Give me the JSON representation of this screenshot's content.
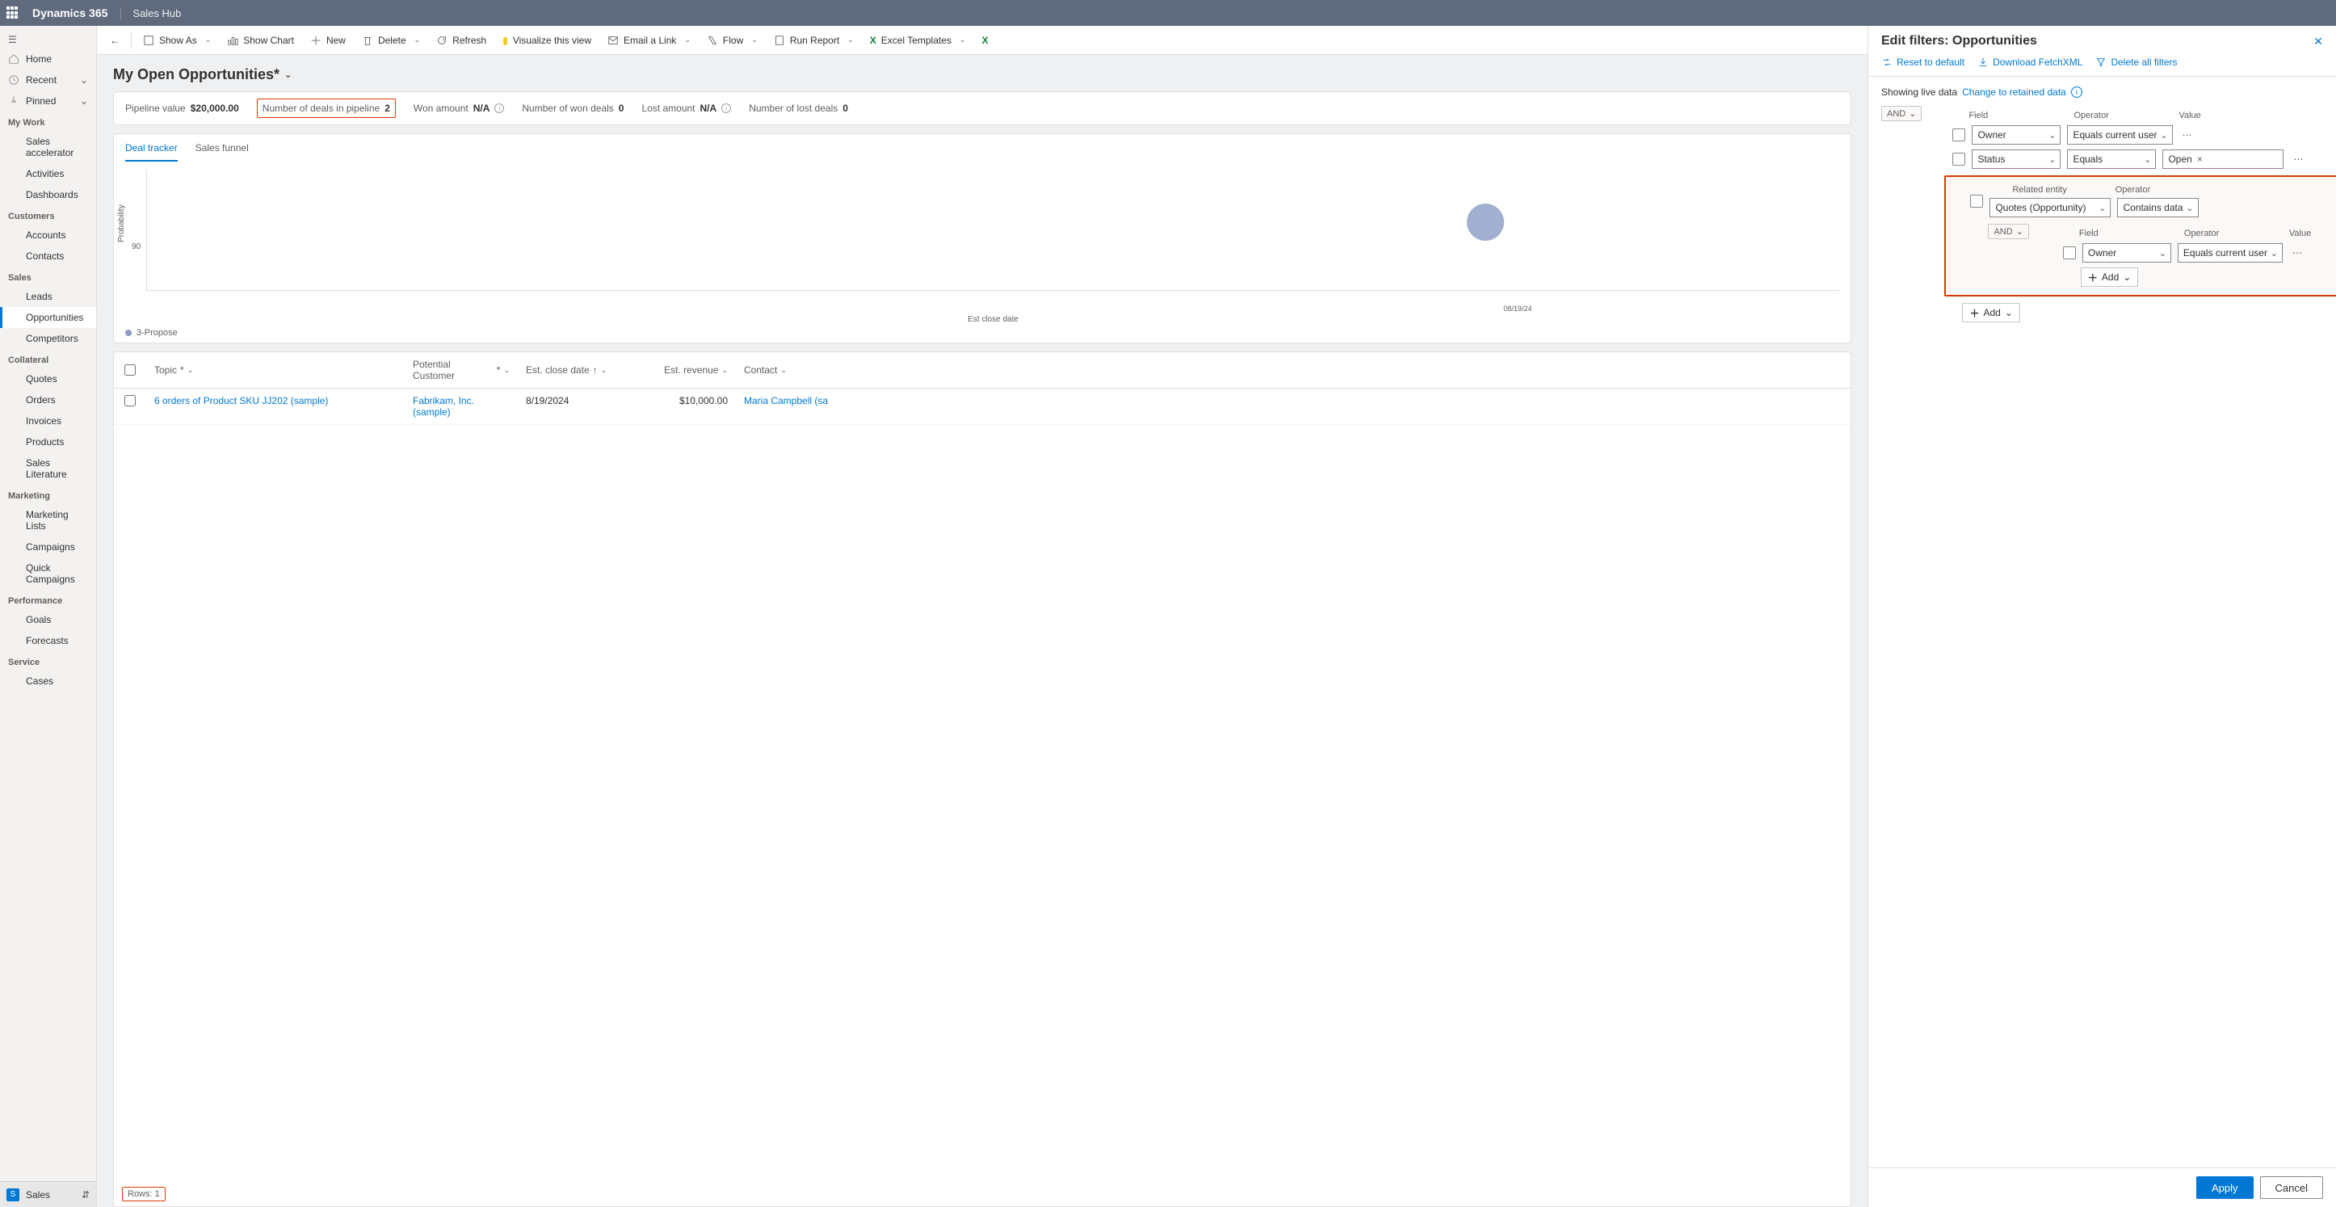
{
  "topbar": {
    "brand": "Dynamics 365",
    "app": "Sales Hub"
  },
  "sidebar": {
    "top": [
      {
        "label": "Home"
      },
      {
        "label": "Recent",
        "chev": true
      },
      {
        "label": "Pinned",
        "chev": true
      }
    ],
    "sections": [
      {
        "title": "My Work",
        "items": [
          "Sales accelerator",
          "Activities",
          "Dashboards"
        ]
      },
      {
        "title": "Customers",
        "items": [
          "Accounts",
          "Contacts"
        ]
      },
      {
        "title": "Sales",
        "items": [
          "Leads",
          "Opportunities",
          "Competitors"
        ],
        "active": 1
      },
      {
        "title": "Collateral",
        "items": [
          "Quotes",
          "Orders",
          "Invoices",
          "Products",
          "Sales Literature"
        ]
      },
      {
        "title": "Marketing",
        "items": [
          "Marketing Lists",
          "Campaigns",
          "Quick Campaigns"
        ]
      },
      {
        "title": "Performance",
        "items": [
          "Goals",
          "Forecasts"
        ]
      },
      {
        "title": "Service",
        "items": [
          "Cases"
        ]
      }
    ],
    "area": {
      "letter": "S",
      "label": "Sales"
    }
  },
  "cmdbar": {
    "back": "←",
    "showAs": "Show As",
    "showChart": "Show Chart",
    "new": "New",
    "delete": "Delete",
    "refresh": "Refresh",
    "visualize": "Visualize this view",
    "email": "Email a Link",
    "flow": "Flow",
    "report": "Run Report",
    "excel": "Excel Templates"
  },
  "view": {
    "title": "My Open Opportunities*",
    "metrics": {
      "pipelineLabel": "Pipeline value",
      "pipelineValue": "$20,000.00",
      "dealsLabel": "Number of deals in pipeline",
      "dealsValue": "2",
      "wonAmtLabel": "Won amount",
      "wonAmtValue": "N/A",
      "wonDealsLabel": "Number of won deals",
      "wonDealsValue": "0",
      "lostAmtLabel": "Lost amount",
      "lostAmtValue": "N/A",
      "lostDealsLabel": "Number of lost deals",
      "lostDealsValue": "0"
    },
    "tabs": {
      "t1": "Deal tracker",
      "t2": "Sales funnel"
    },
    "chart": {
      "ylabel": "Probability",
      "ytick": "90",
      "xtick": "08/19/24",
      "xlabel": "Est close date",
      "legend": "3-Propose"
    },
    "grid": {
      "cols": {
        "topic": "Topic",
        "customer": "Potential Customer",
        "close": "Est. close date",
        "rev": "Est. revenue",
        "contact": "Contact"
      },
      "row": {
        "topic": "6 orders of Product SKU JJ202 (sample)",
        "customer": "Fabrikam, Inc. (sample)",
        "close": "8/19/2024",
        "rev": "$10,000.00",
        "contact": "Maria Campbell (sa"
      },
      "rowsLabel": "Rows: 1"
    }
  },
  "panel": {
    "title": "Edit filters: Opportunities",
    "actions": {
      "reset": "Reset to default",
      "fetch": "Download FetchXML",
      "deleteAll": "Delete all filters"
    },
    "live": {
      "text": "Showing live data",
      "link": "Change to retained data"
    },
    "group": "AND",
    "colhead": {
      "field": "Field",
      "operator": "Operator",
      "value": "Value"
    },
    "rows": {
      "r1": {
        "field": "Owner",
        "op": "Equals current user"
      },
      "r2": {
        "field": "Status",
        "op": "Equals",
        "val": "Open"
      }
    },
    "related": {
      "labelField": "Related entity",
      "labelOp": "Operator",
      "entity": "Quotes (Opportunity)",
      "op": "Contains data",
      "group": "AND",
      "row": {
        "field": "Owner",
        "op": "Equals current user"
      },
      "add": "Add"
    },
    "addOuter": "Add",
    "buttons": {
      "apply": "Apply",
      "cancel": "Cancel"
    }
  }
}
